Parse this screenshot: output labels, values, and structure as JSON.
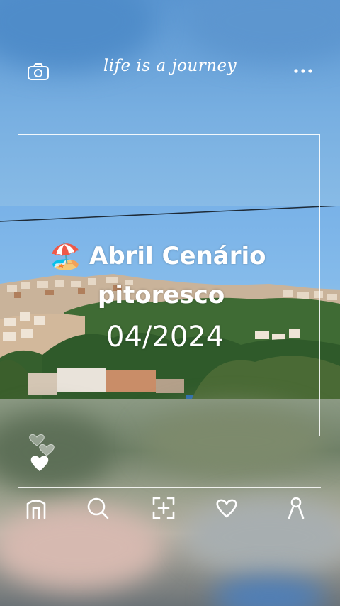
{
  "header": {
    "title": "life is a journey",
    "left_icon": "camera-icon",
    "right_icon": "more-icon"
  },
  "post": {
    "caption_emoji": "🏖️",
    "caption_line1": "Abril Cenário",
    "caption_line2": "pitoresco",
    "caption_line3": "04/2024"
  },
  "reactions": {
    "icons": [
      "heart-outline-icon",
      "heart-outline-icon",
      "heart-filled-icon"
    ]
  },
  "bottom_nav": {
    "items": [
      {
        "icon": "home-icon"
      },
      {
        "icon": "search-icon"
      },
      {
        "icon": "add-post-icon"
      },
      {
        "icon": "heart-icon"
      },
      {
        "icon": "profile-icon"
      }
    ]
  },
  "colors": {
    "overlay_text": "#ffffff",
    "sky": "#78afe1"
  }
}
